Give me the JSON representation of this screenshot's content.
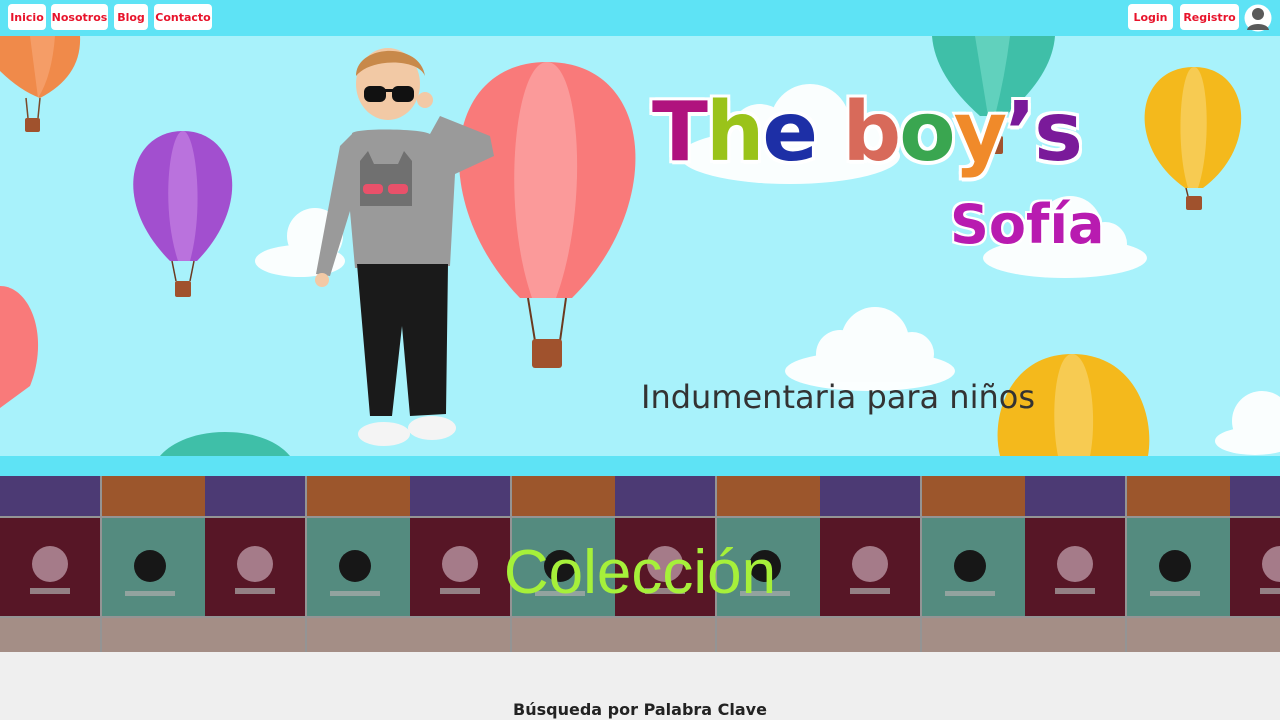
{
  "nav": {
    "left": [
      {
        "label": "Inicio"
      },
      {
        "label": "Nosotros"
      },
      {
        "label": "Blog"
      },
      {
        "label": "Contacto"
      }
    ],
    "right": [
      {
        "label": "Login"
      },
      {
        "label": "Registro"
      }
    ],
    "user_icon": "user-avatar-icon"
  },
  "hero": {
    "title_letters": [
      {
        "char": "T",
        "color": "#b0127e"
      },
      {
        "char": "h",
        "color": "#9ac31a"
      },
      {
        "char": "e",
        "color": "#1d2fa6"
      },
      {
        "char": " ",
        "color": "#000000"
      },
      {
        "char": "b",
        "color": "#d86a5a"
      },
      {
        "char": "o",
        "color": "#3aa650"
      },
      {
        "char": "y",
        "color": "#f08a2a"
      },
      {
        "char": "’s",
        "color": "#7a1a9a"
      }
    ],
    "subtitle": "Sofía",
    "tagline": "Indumentaria para niños"
  },
  "collection": {
    "title": "Colección"
  },
  "search": {
    "title": "Búsqueda por Palabra Clave"
  },
  "colors": {
    "nav_bg": "#5ee3f5",
    "hero_bg": "#a8f2fb",
    "nav_text": "#e8132b",
    "collection_text": "#a6f03a"
  }
}
